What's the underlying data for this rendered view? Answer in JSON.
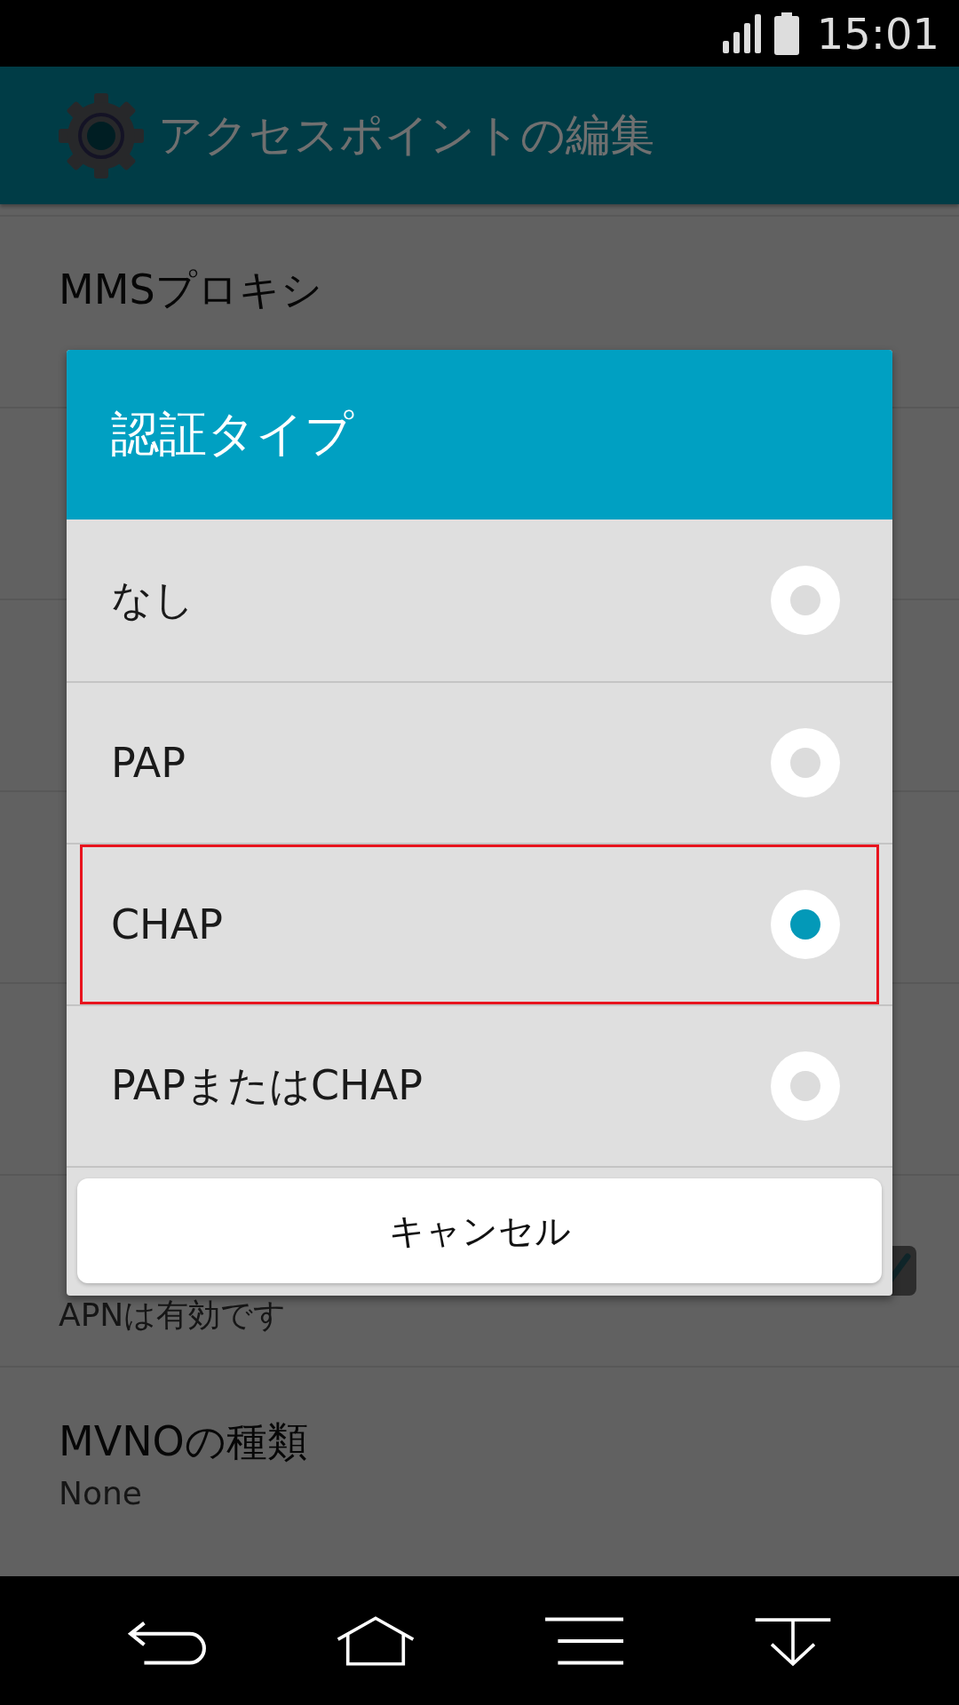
{
  "status_bar": {
    "time": "15:01"
  },
  "app_bar": {
    "title": "アクセスポイントの編集"
  },
  "settings": [
    {
      "kind": "text",
      "title": "MMSプロキシ"
    },
    {
      "kind": "hidden"
    },
    {
      "kind": "hidden"
    },
    {
      "kind": "hidden"
    },
    {
      "kind": "hidden"
    },
    {
      "kind": "check",
      "summary": "APNは有効です",
      "checked": true
    },
    {
      "kind": "text",
      "title": "MVNOの種類",
      "summary": "None"
    }
  ],
  "dialog": {
    "title": "認証タイプ",
    "options": [
      {
        "label": "なし",
        "selected": false,
        "highlighted": false
      },
      {
        "label": "PAP",
        "selected": false,
        "highlighted": false
      },
      {
        "label": "CHAP",
        "selected": true,
        "highlighted": true
      },
      {
        "label": "PAPまたはCHAP",
        "selected": false,
        "highlighted": false
      }
    ],
    "cancel": "キャンセル"
  }
}
